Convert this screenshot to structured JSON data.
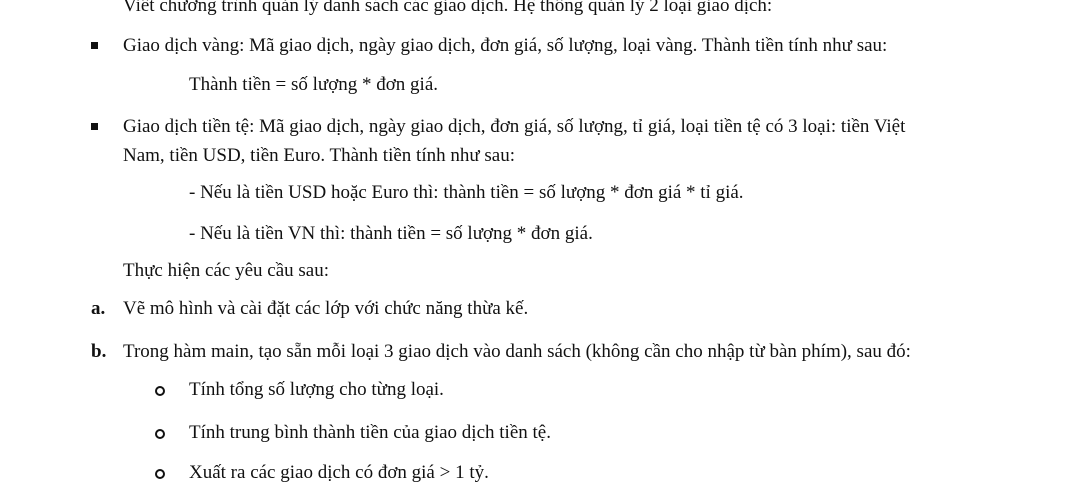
{
  "intro": "Viết chương trình quản lý danh sách các giao dịch. Hệ thống quản lý 2 loại giao dịch:",
  "gold": {
    "line1": "Giao dịch vàng: Mã giao dịch, ngày giao dịch, đơn giá, số lượng, loại vàng. Thành tiền tính như sau:",
    "formula": "Thành tiền = số lượng * đơn giá."
  },
  "currency": {
    "line1": "Giao dịch tiền tệ: Mã giao dịch, ngày giao dịch, đơn giá, số lượng, tỉ giá, loại tiền tệ có 3 loại: tiền Việt",
    "line2": "Nam, tiền USD, tiền Euro. Thành tiền tính như sau:",
    "rule_usd": "- Nếu là tiền USD hoặc Euro thì: thành tiền = số lượng * đơn giá * tỉ giá.",
    "rule_vn": "- Nếu là tiền VN thì: thành tiền = số lượng * đơn giá."
  },
  "requirements_heading": "Thực hiện các yêu cầu sau:",
  "req_a": {
    "marker": "a.",
    "text": "Vẽ mô hình và cài đặt các lớp với chức năng thừa kế."
  },
  "req_b": {
    "marker": "b.",
    "text": "Trong hàm main, tạo sẵn mỗi loại 3 giao dịch vào danh sách (không cần cho nhập từ bàn phím), sau đó:",
    "subitems": [
      "Tính tổng số lượng cho từng loại.",
      "Tính trung bình thành tiền của giao dịch tiền tệ.",
      "Xuất ra các giao dịch có đơn giá > 1 tỷ."
    ]
  }
}
